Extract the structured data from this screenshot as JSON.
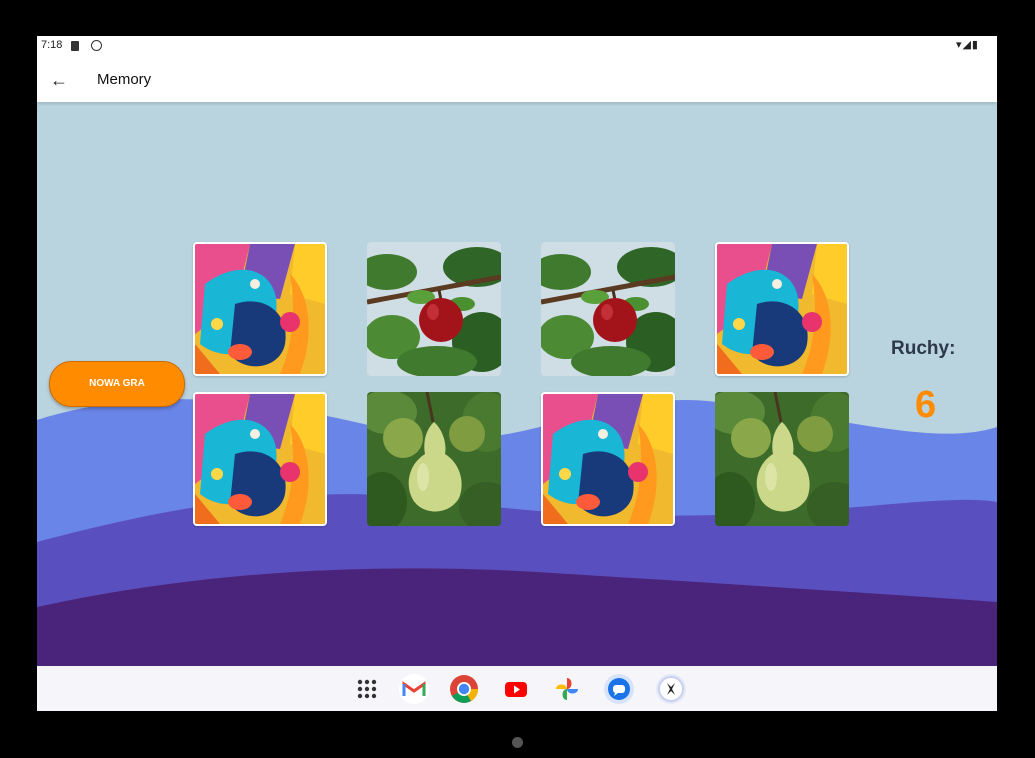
{
  "status_bar": {
    "time": "7:18",
    "system_icons": "▾◢▮"
  },
  "app_bar": {
    "back_icon": "arrow-back-icon",
    "title": "Memory"
  },
  "game": {
    "new_game_label": "NOWA GRA",
    "moves_label": "Ruchy:",
    "moves_value": "6",
    "cards": [
      {
        "row": 1,
        "col": 1,
        "state": "face-down"
      },
      {
        "row": 1,
        "col": 2,
        "state": "face-up",
        "image": "apple"
      },
      {
        "row": 1,
        "col": 3,
        "state": "face-up",
        "image": "apple"
      },
      {
        "row": 1,
        "col": 4,
        "state": "face-down"
      },
      {
        "row": 2,
        "col": 1,
        "state": "face-down"
      },
      {
        "row": 2,
        "col": 2,
        "state": "face-up",
        "image": "pear"
      },
      {
        "row": 2,
        "col": 3,
        "state": "face-down"
      },
      {
        "row": 2,
        "col": 4,
        "state": "face-up",
        "image": "pear"
      }
    ]
  },
  "dock": {
    "apps": [
      "app-drawer-icon",
      "gmail-icon",
      "chrome-icon",
      "youtube-icon",
      "photos-icon",
      "messages-icon",
      "app-icon"
    ]
  },
  "colors": {
    "accent": "#ff8c00",
    "sky": "#b9d3df",
    "wave_light": "#6a85e8",
    "wave_mid": "#5a4fbf",
    "wave_dark": "#4a247a"
  }
}
